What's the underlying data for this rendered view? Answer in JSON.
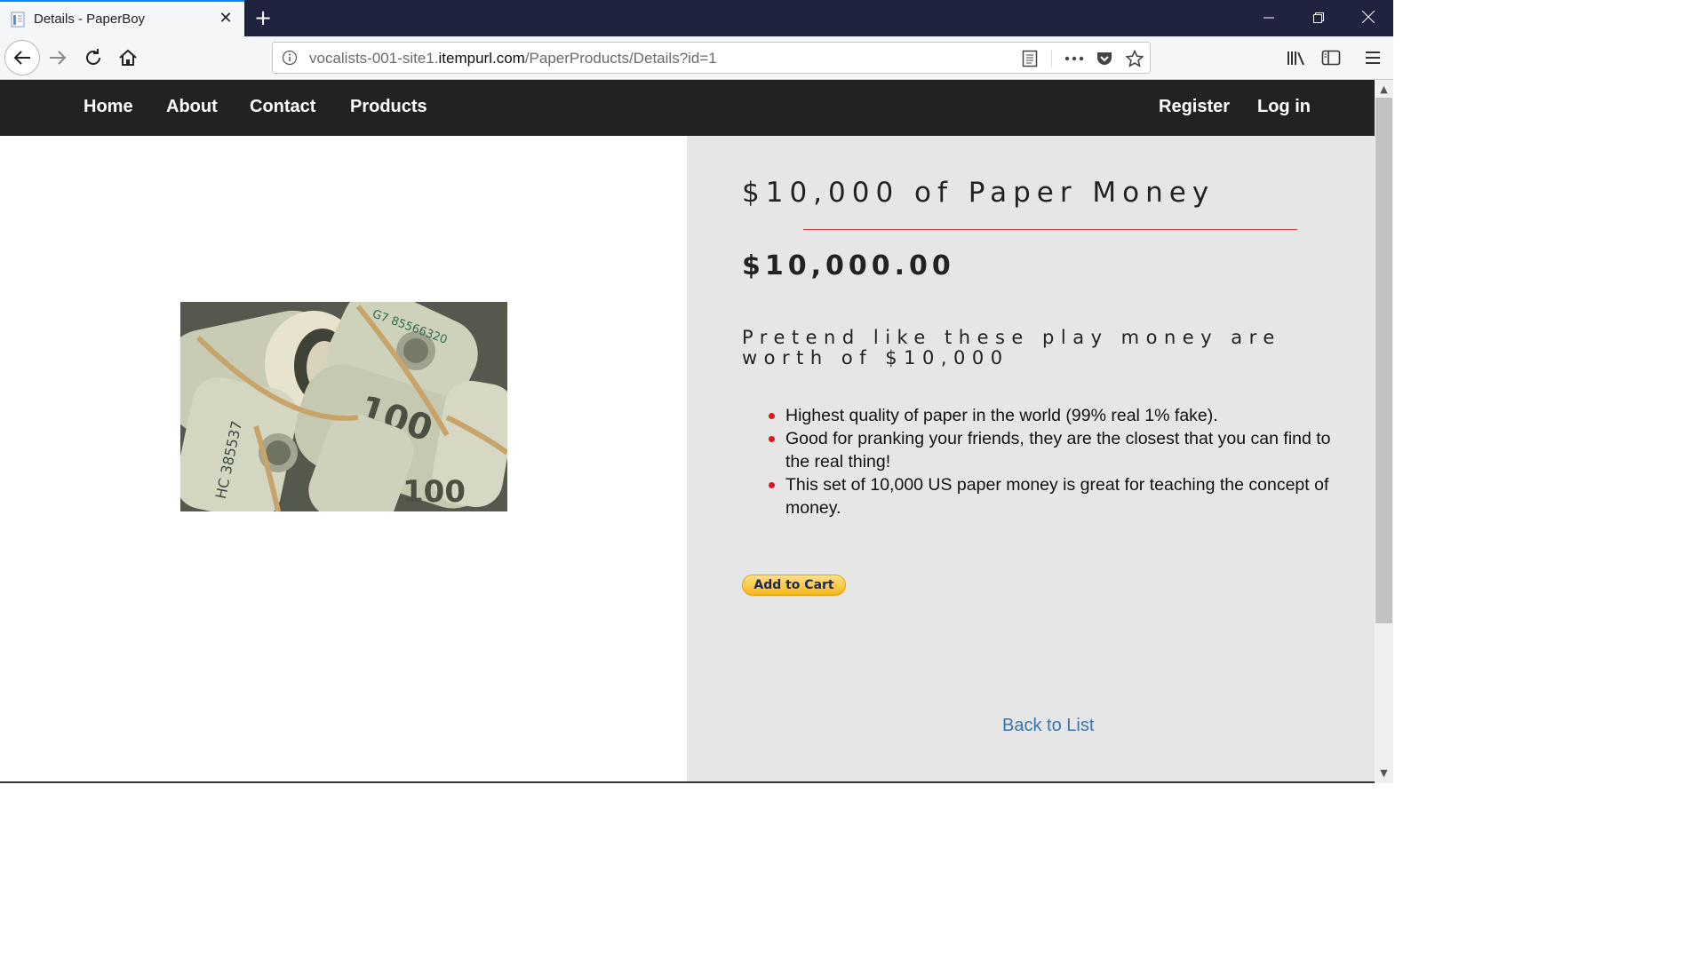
{
  "browser": {
    "tab_title": "Details - PaperBoy",
    "tab_close": "✕",
    "new_tab": "+",
    "url_prefix": "vocalists-001-site1.",
    "url_domain": "itempurl.com",
    "url_path": "/PaperProducts/Details?id=1",
    "window_controls": {
      "minimize": "—",
      "restore": "❐",
      "close": "✕"
    },
    "accent_color": "#0a84ff",
    "tabbar_color": "#202340"
  },
  "site_nav": {
    "left": [
      "Home",
      "About",
      "Contact",
      "Products"
    ],
    "right": [
      "Register",
      "Log in"
    ]
  },
  "product": {
    "title": "$10,000 of Paper Money",
    "price": "$10,000.00",
    "description": "Pretend like these play money are worth of $10,000",
    "features": [
      "Highest quality of paper in the world (99% real 1% fake).",
      "Good for pranking your friends, they are the closest that you can find to the real thing!",
      "This set of 10,000 US paper money is great for teaching the concept of money."
    ],
    "add_to_cart": "Add to Cart",
    "back_link": "Back to List",
    "image_alt": "rolls of 100 dollar bills",
    "rule_color": "#d9363e",
    "bullet_color": "#e0141e"
  },
  "icons": {
    "back": "arrow-left-icon",
    "forward": "arrow-right-icon",
    "reload": "reload-icon",
    "home": "home-icon",
    "info": "info-icon",
    "reader": "reader-view-icon",
    "more": "more-icon",
    "pocket": "pocket-icon",
    "bookmark": "star-icon",
    "library": "library-icon",
    "sidebar": "sidebar-icon",
    "menu": "hamburger-menu-icon"
  }
}
